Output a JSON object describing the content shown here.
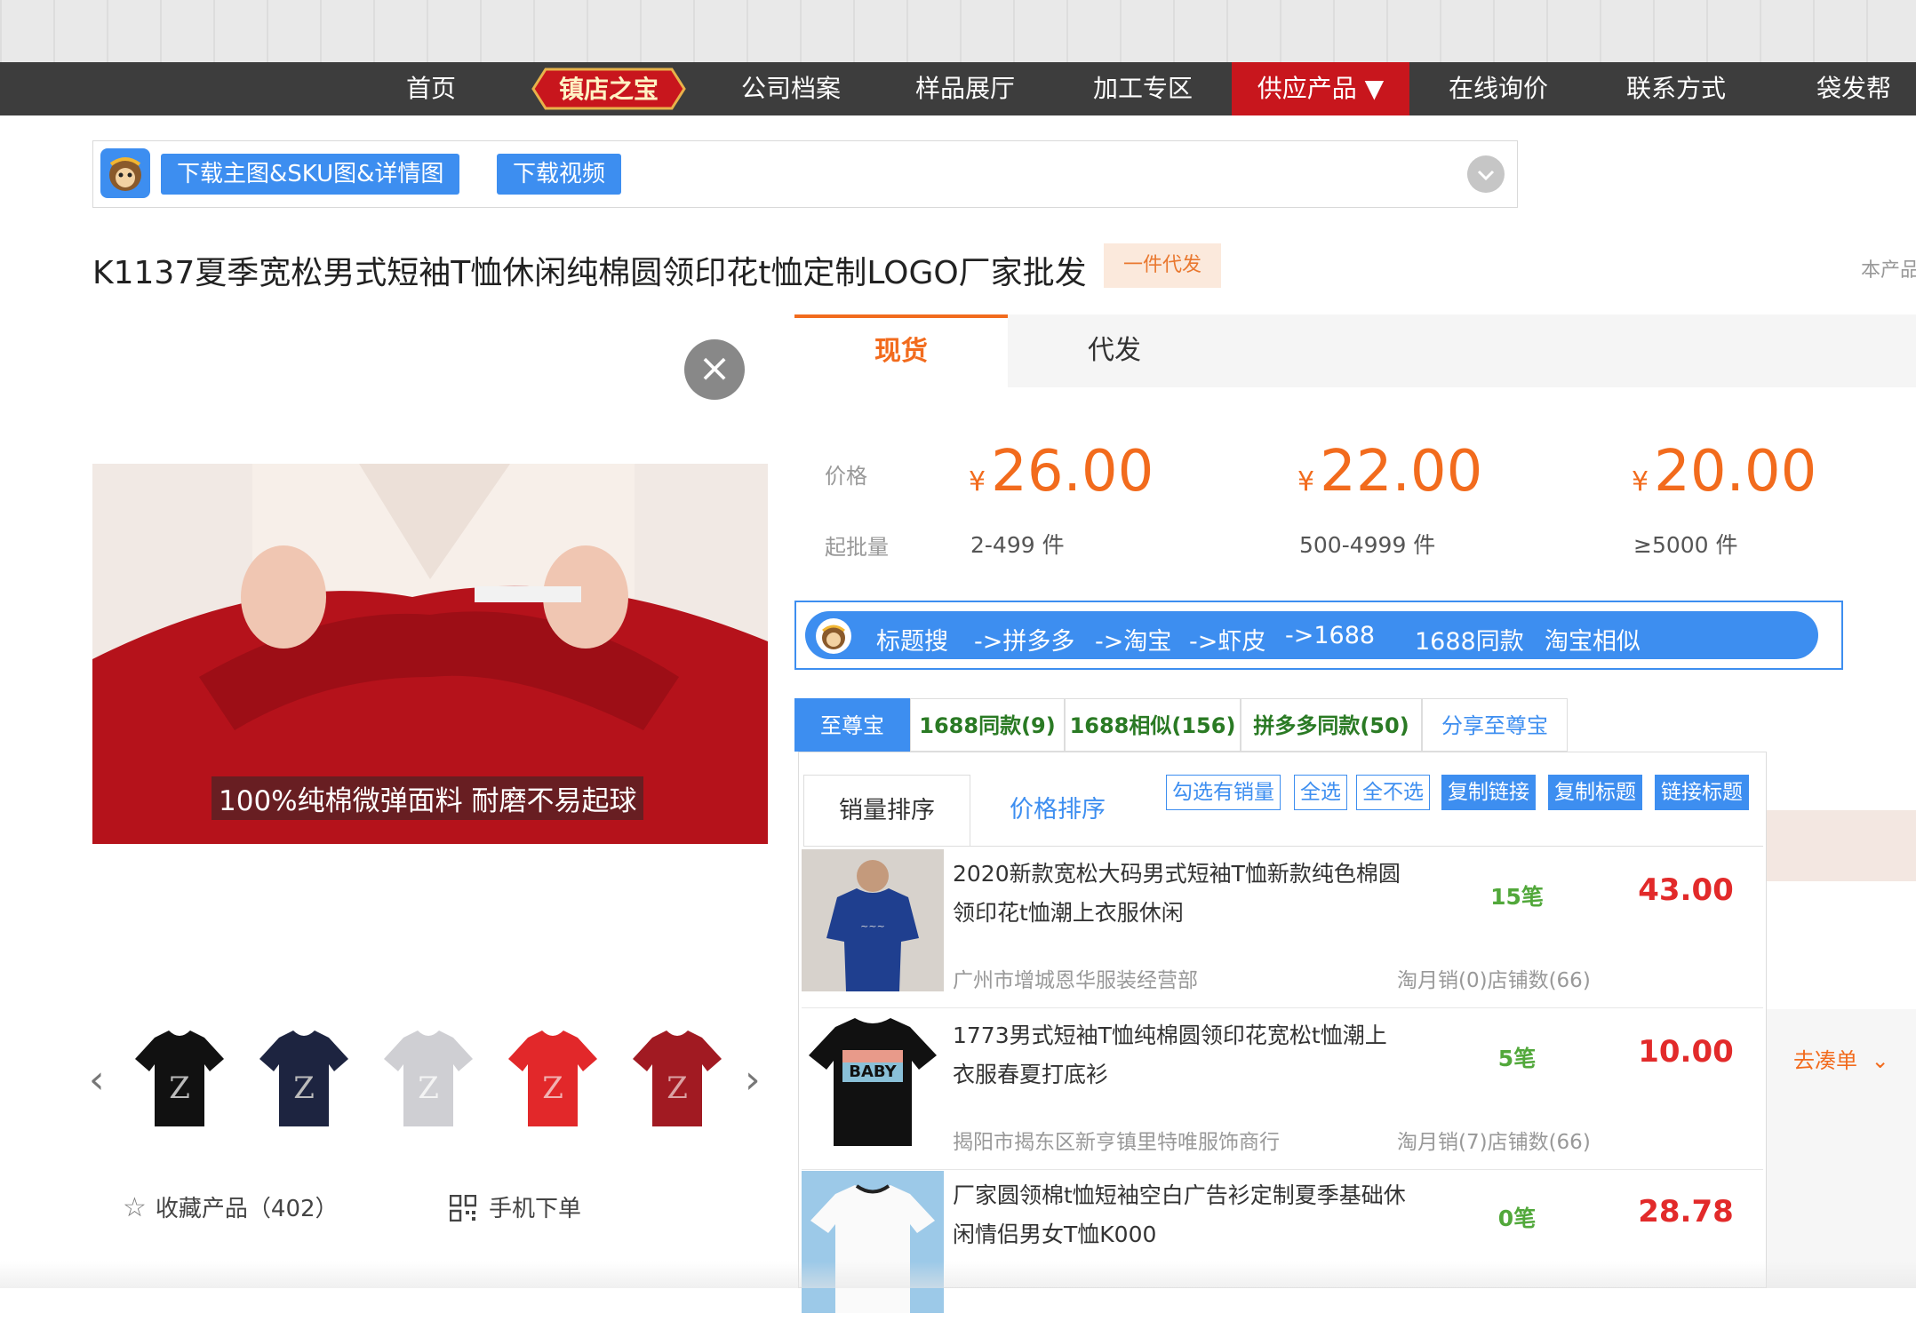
{
  "nav": {
    "items": [
      "首页",
      "镇店之宝",
      "公司档案",
      "样品展厅",
      "加工专区",
      "供应产品 ▼",
      "在线询价",
      "联系方式",
      "袋发帮"
    ]
  },
  "plugin": {
    "download_images": "下载主图&SKU图&详情图",
    "download_video": "下载视频"
  },
  "product": {
    "title": "K1137夏季宽松男式短袖T恤休闲纯棉圆领印花t恤定制LOGO厂家批发",
    "tag": "一件代发",
    "side_note": "本产品"
  },
  "video": {
    "subtitle": "100%纯棉微弹面料  耐磨不易起球"
  },
  "actions": {
    "favorite": "收藏产品（402）",
    "mobile_order": "手机下单"
  },
  "tabs": {
    "in_stock": "现货",
    "dropship": "代发"
  },
  "pricing": {
    "price_label": "价格",
    "moq_label": "起批量",
    "currency": "¥",
    "tiers": [
      {
        "price": "26.00",
        "qty": "2-499 件"
      },
      {
        "price": "22.00",
        "qty": "500-4999 件"
      },
      {
        "price": "20.00",
        "qty": "≥5000 件"
      }
    ]
  },
  "search_bar": [
    "标题搜",
    "->拼多多",
    "->淘宝",
    "->虾皮",
    "->1688",
    "1688同款",
    "淘宝相似"
  ],
  "tool_tabs": [
    "至尊宝",
    "1688同款(9)",
    "1688相似(156)",
    "拼多多同款(50)",
    "分享至尊宝"
  ],
  "sort": {
    "by_sales": "销量排序",
    "by_price": "价格排序"
  },
  "ops": [
    "勾选有销量",
    "全选",
    "全不选",
    "复制链接",
    "复制标题",
    "链接标题"
  ],
  "results": [
    {
      "name": "2020新款宽松大码男式短袖T恤新款纯色棉圆领印花t恤潮上衣服休闲",
      "shop": "广州市增城恩华服装经营部",
      "sold": "15笔",
      "price": "43.00",
      "stat": "淘月销(0)店铺数(66)"
    },
    {
      "name": "1773男式短袖T恤纯棉圆领印花宽松t恤潮上衣服春夏打底衫",
      "shop": "揭阳市揭东区新亨镇里特唯服饰商行",
      "sold": "5笔",
      "price": "10.00",
      "stat": "淘月销(7)店铺数(66)"
    },
    {
      "name": "厂家圆领棉t恤短袖空白广告衫定制夏季基础休闲情侣男女T恤K000",
      "shop": "",
      "sold": "0笔",
      "price": "28.78",
      "stat": ""
    }
  ],
  "side": {
    "order": "去凑单"
  },
  "colors": {
    "accent": "#f26b1d",
    "blue": "#3d8ef0",
    "nav_active": "#c8161d",
    "price_red": "#e22a2a",
    "sold_green": "#52a83b"
  }
}
